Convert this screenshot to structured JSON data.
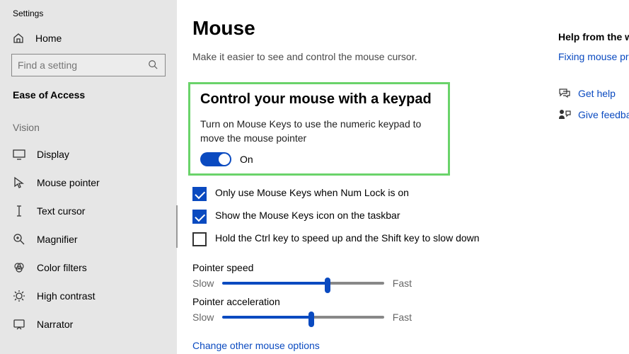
{
  "window_title": "Settings",
  "home_label": "Home",
  "search": {
    "placeholder": "Find a setting"
  },
  "section_bold": "Ease of Access",
  "group_label": "Vision",
  "nav": {
    "display": "Display",
    "mouse_pointer": "Mouse pointer",
    "text_cursor": "Text cursor",
    "magnifier": "Magnifier",
    "color_filters": "Color filters",
    "high_contrast": "High contrast",
    "narrator": "Narrator"
  },
  "page": {
    "heading": "Mouse",
    "subheading": "Make it easier to see and control the mouse cursor."
  },
  "keypad": {
    "heading": "Control your mouse with a keypad",
    "desc": "Turn on Mouse Keys to use the numeric keypad to move the mouse pointer",
    "toggle_label": "On",
    "check_numlock": "Only use Mouse Keys when Num Lock is on",
    "check_taskbar": "Show the Mouse Keys icon on the taskbar",
    "check_ctrl": "Hold the Ctrl key to speed up and the Shift key to slow down"
  },
  "slider": {
    "speed_label": "Pointer speed",
    "accel_label": "Pointer acceleration",
    "slow": "Slow",
    "fast": "Fast"
  },
  "link_other": "Change other mouse options",
  "help": {
    "heading": "Help from the web",
    "link1": "Fixing mouse proble",
    "get_help": "Get help",
    "feedback": "Give feedback"
  }
}
